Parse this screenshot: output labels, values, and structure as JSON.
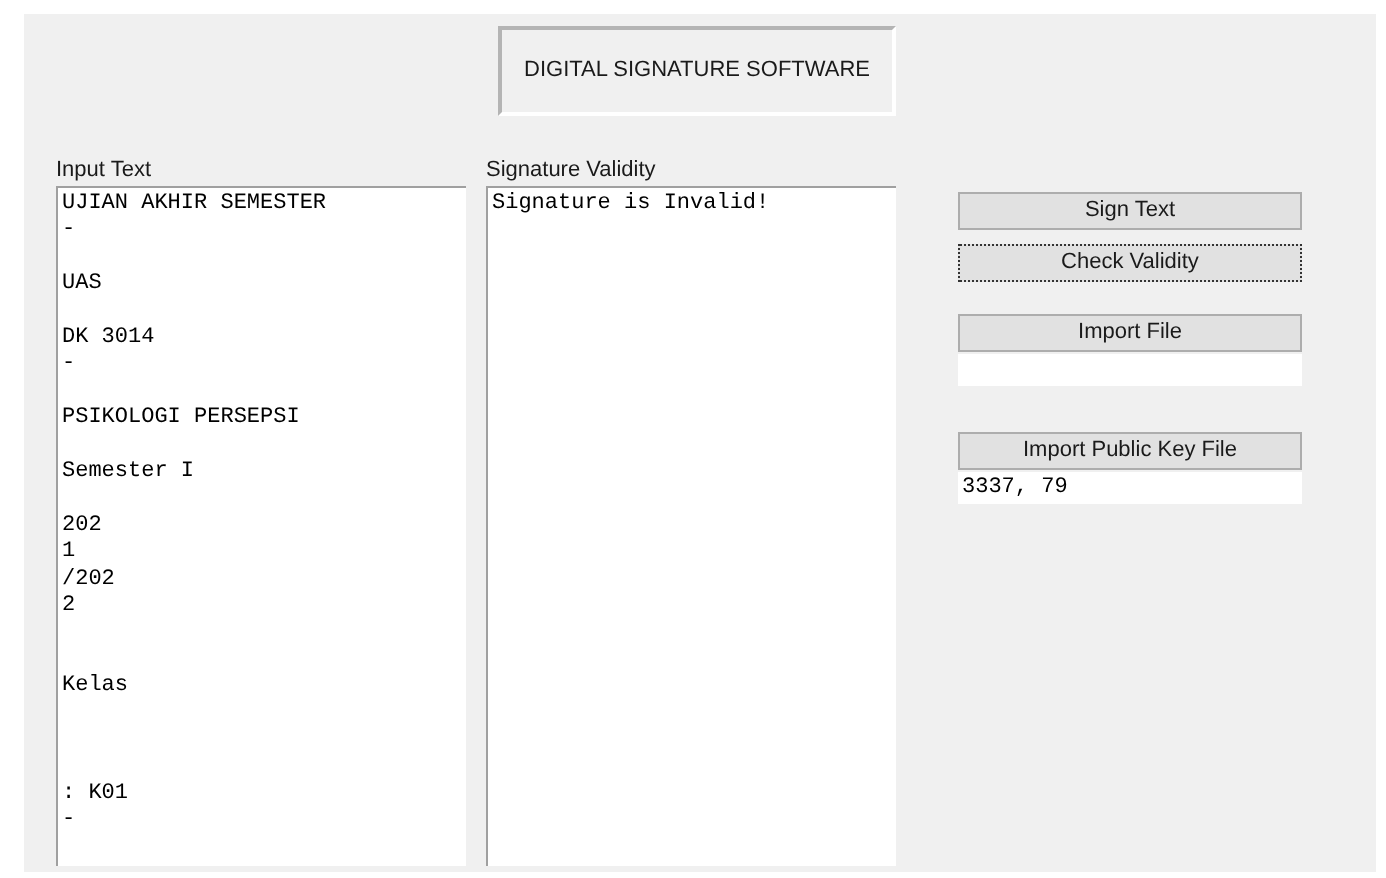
{
  "title": "DIGITAL SIGNATURE SOFTWARE",
  "input_text": {
    "label": "Input Text",
    "value": "UJIAN AKHIR SEMESTER\n-\n\nUAS\n\nDK 3014\n-\n\nPSIKOLOGI PERSEPSI\n\nSemester I\n\n202\n1\n/202\n2\n\n\nKelas\n\n\n\n: K01\n-"
  },
  "signature_validity": {
    "label": "Signature Validity",
    "value": "Signature is Invalid!"
  },
  "actions": [
    {
      "label": "Sign Text",
      "focused": false
    },
    {
      "label": "Check Validity",
      "focused": true
    }
  ],
  "import_file": {
    "label": "Import File",
    "focused": false
  },
  "import_key": {
    "label": "Import Public Key File",
    "focused": false,
    "value": "3337, 79"
  }
}
